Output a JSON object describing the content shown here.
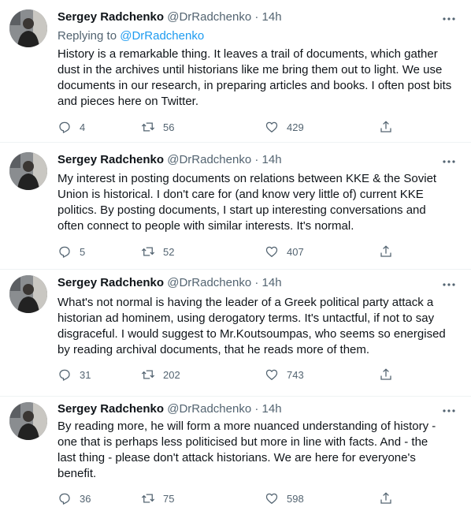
{
  "tweets": [
    {
      "name": "Sergey Radchenko",
      "handle": "@DrRadchenko",
      "dot": "·",
      "time": "14h",
      "reply_prefix": "Replying to ",
      "reply_to": "@DrRadchenko",
      "text": "History is a remarkable thing. It leaves a trail of documents, which gather\ndust in the archives until historians like me bring them out to light. We use\ndocuments in our research, in preparing articles and books. I often post bits\nand pieces here on Twitter.",
      "replies": "4",
      "retweets": "56",
      "likes": "429"
    },
    {
      "name": "Sergey Radchenko",
      "handle": "@DrRadchenko",
      "dot": "·",
      "time": "14h",
      "text": "My interest in posting documents on relations between KKE & the Soviet\nUnion is historical. I don't care for (and know very little of) current KKE\npolitics. By posting documents, I start up interesting conversations and\noften connect to people with similar interests. It's normal.",
      "replies": "5",
      "retweets": "52",
      "likes": "407"
    },
    {
      "name": "Sergey Radchenko",
      "handle": "@DrRadchenko",
      "dot": "·",
      "time": "14h",
      "text": "What's not normal is having the leader of a Greek political party attack a\nhistorian ad hominem, using derogatory terms. It's untactful, if not to say\ndisgraceful. I would suggest to Mr.Koutsoumpas, who seems so energised\nby reading archival documents, that he reads more of them.",
      "replies": "31",
      "retweets": "202",
      "likes": "743"
    },
    {
      "name": "Sergey Radchenko",
      "handle": "@DrRadchenko",
      "dot": "·",
      "time": "14h",
      "text": "By reading more, he will form a more nuanced understanding of history -\none that is perhaps less politicised but more in line with facts. And - the\nlast thing - please don't attack historians. We are here for everyone's\nbenefit.",
      "replies": "36",
      "retweets": "75",
      "likes": "598"
    }
  ],
  "icons": {
    "avatar": "profile-photo",
    "more": "more-dots-icon",
    "reply": "reply-bubble-icon",
    "retweet": "retweet-icon",
    "like": "heart-icon",
    "share": "share-icon"
  },
  "colors": {
    "text": "#0f1419",
    "secondary": "#536471",
    "link": "#1d9bf0",
    "divider": "#eff3f4"
  }
}
